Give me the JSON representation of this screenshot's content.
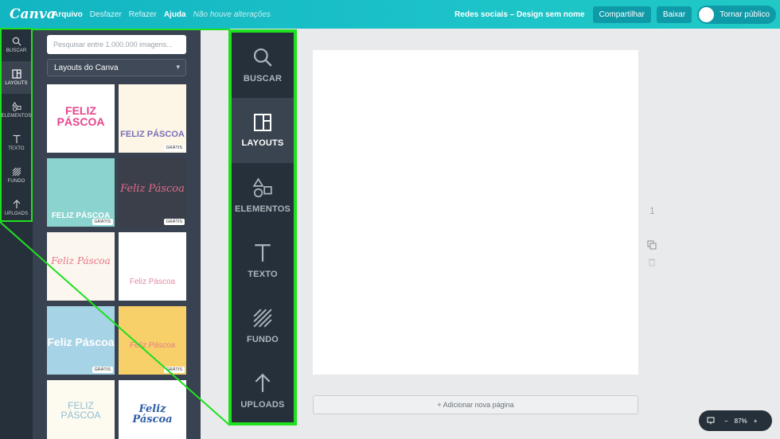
{
  "topbar": {
    "logo": "Canva",
    "menu": [
      "Arquivo",
      "Desfazer",
      "Refazer",
      "Ajuda"
    ],
    "status": "Não houve alterações",
    "design_name": "Redes sociais – Design sem nome",
    "share_label": "Compartilhar",
    "download_label": "Baixar",
    "public_label": "Tornar público"
  },
  "nav": {
    "items": [
      {
        "label": "BUSCAR",
        "icon": "search-icon"
      },
      {
        "label": "LAYOUTS",
        "icon": "layouts-icon"
      },
      {
        "label": "ELEMENTOS",
        "icon": "shapes-icon"
      },
      {
        "label": "TEXTO",
        "icon": "text-icon"
      },
      {
        "label": "FUNDO",
        "icon": "background-icon"
      },
      {
        "label": "UPLOADS",
        "icon": "upload-icon"
      }
    ],
    "selected": "LAYOUTS"
  },
  "panel": {
    "search_placeholder": "Pesquisar entre 1.000.000 imagens...",
    "select_value": "Layouts do Canva",
    "badge": "GRÁTIS",
    "thumbs": [
      {
        "title": "FELIZ PÁSCOA",
        "bg": "#ffffff",
        "color": "#e5458c"
      },
      {
        "title": "FELIZ PÁSCOA",
        "bg": "#fdf6e6",
        "color": "#7a6fb8"
      },
      {
        "title": "FELIZ PÁSCOA",
        "bg": "#8ad3cf",
        "color": "#ffffff"
      },
      {
        "title": "Feliz Páscoa",
        "bg": "#3a3f4a",
        "color": "#e36b8b"
      },
      {
        "title": "Feliz Páscoa",
        "bg": "#fbf6ee",
        "color": "#e8768d"
      },
      {
        "title": "Feliz Páscoa",
        "bg": "#ffffff",
        "color": "#e48aa1"
      },
      {
        "title": "Feliz Páscoa",
        "bg": "#a7d3e6",
        "color": "#ffffff"
      },
      {
        "title": "Feliz Páscoa",
        "bg": "#f8d06a",
        "color": "#e67a8a"
      },
      {
        "title": "FELIZ PÁSCOA",
        "bg": "#fdfbef",
        "color": "#8fbcd4"
      },
      {
        "title": "Feliz Páscoa",
        "bg": "#ffffff",
        "color": "#2c5fa8"
      }
    ]
  },
  "canvas": {
    "add_page": "+ Adicionar nova página",
    "page_number": "1",
    "zoom": "87%"
  },
  "colors": {
    "highlight": "#1fe01f",
    "accent": "#1cc3c8"
  }
}
